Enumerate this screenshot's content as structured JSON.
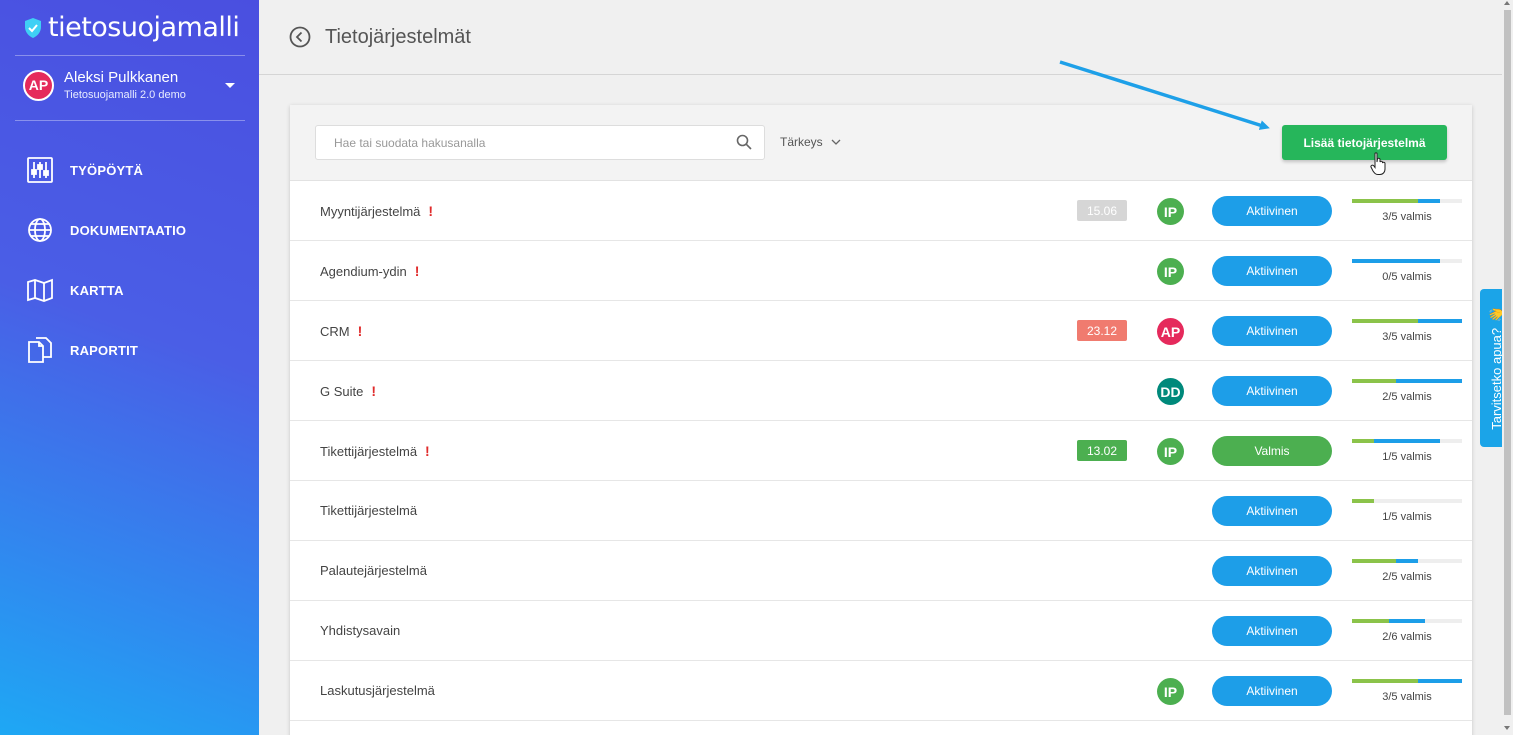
{
  "app": {
    "logo_text": "tietosuojamalli"
  },
  "user": {
    "initials": "AP",
    "name": "Aleksi Pulkkanen",
    "org": "Tietosuojamalli 2.0 demo"
  },
  "nav": [
    {
      "label": "TYÖPÖYTÄ",
      "icon": "sliders-icon"
    },
    {
      "label": "DOKUMENTAATIO",
      "icon": "globe-icon"
    },
    {
      "label": "KARTTA",
      "icon": "map-icon"
    },
    {
      "label": "RAPORTIT",
      "icon": "documents-icon"
    }
  ],
  "header": {
    "title": "Tietojärjestelmät"
  },
  "toolbar": {
    "search_placeholder": "Hae tai suodata hakusanalla",
    "sort_label": "Tärkeys",
    "add_label": "Lisää tietojärjestelmä"
  },
  "colors": {
    "green": "#26b65b",
    "blue": "#1d9ee8",
    "grey_badge": "#d6d6d6",
    "red_badge": "#f07b6f",
    "green_badge": "#4caf50"
  },
  "rows": [
    {
      "name": "Myyntijärjestelmä",
      "important": true,
      "date": "15.06",
      "date_color": "#d6d6d6",
      "owner": "IP",
      "owner_color": "#4caf50",
      "status": "Aktiivinen",
      "status_color": "#1d9ee8",
      "progress_label": "3/5 valmis",
      "done": 3,
      "in_progress": 1,
      "total": 5
    },
    {
      "name": "Agendium-ydin",
      "important": true,
      "date": "",
      "date_color": "",
      "owner": "IP",
      "owner_color": "#4caf50",
      "status": "Aktiivinen",
      "status_color": "#1d9ee8",
      "progress_label": "0/5 valmis",
      "done": 0,
      "in_progress": 4,
      "total": 5
    },
    {
      "name": "CRM",
      "important": true,
      "date": "23.12",
      "date_color": "#f07b6f",
      "owner": "AP",
      "owner_color": "#e52a5c",
      "status": "Aktiivinen",
      "status_color": "#1d9ee8",
      "progress_label": "3/5 valmis",
      "done": 3,
      "in_progress": 2,
      "total": 5
    },
    {
      "name": "G Suite",
      "important": true,
      "date": "",
      "date_color": "",
      "owner": "DD",
      "owner_color": "#00897b",
      "status": "Aktiivinen",
      "status_color": "#1d9ee8",
      "progress_label": "2/5 valmis",
      "done": 2,
      "in_progress": 3,
      "total": 5
    },
    {
      "name": "Tikettijärjestelmä",
      "important": true,
      "date": "13.02",
      "date_color": "#4caf50",
      "owner": "IP",
      "owner_color": "#4caf50",
      "status": "Valmis",
      "status_color": "#4caf50",
      "progress_label": "1/5 valmis",
      "done": 1,
      "in_progress": 3,
      "total": 5
    },
    {
      "name": "Tikettijärjestelmä",
      "important": false,
      "date": "",
      "date_color": "",
      "owner": "",
      "owner_color": "",
      "status": "Aktiivinen",
      "status_color": "#1d9ee8",
      "progress_label": "1/5 valmis",
      "done": 1,
      "in_progress": 0,
      "total": 5
    },
    {
      "name": "Palautejärjestelmä",
      "important": false,
      "date": "",
      "date_color": "",
      "owner": "",
      "owner_color": "",
      "status": "Aktiivinen",
      "status_color": "#1d9ee8",
      "progress_label": "2/5 valmis",
      "done": 2,
      "in_progress": 1,
      "total": 5
    },
    {
      "name": "Yhdistysavain",
      "important": false,
      "date": "",
      "date_color": "",
      "owner": "",
      "owner_color": "",
      "status": "Aktiivinen",
      "status_color": "#1d9ee8",
      "progress_label": "2/6 valmis",
      "done": 2,
      "in_progress": 2,
      "total": 6
    },
    {
      "name": "Laskutusjärjestelmä",
      "important": false,
      "date": "",
      "date_color": "",
      "owner": "IP",
      "owner_color": "#4caf50",
      "status": "Aktiivinen",
      "status_color": "#1d9ee8",
      "progress_label": "3/5 valmis",
      "done": 3,
      "in_progress": 2,
      "total": 5
    }
  ],
  "help": {
    "label": "Tarvitsetko apua?",
    "emoji": "👋"
  }
}
